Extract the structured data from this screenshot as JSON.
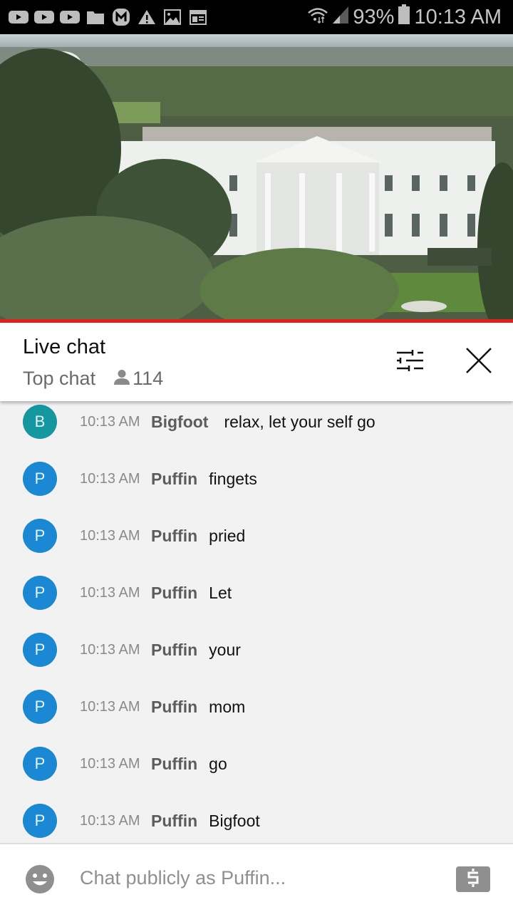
{
  "status_bar": {
    "notification_icons": [
      "youtube-icon",
      "youtube-icon",
      "youtube-icon",
      "folder-icon",
      "m-app-icon",
      "warning-icon",
      "image-icon",
      "news-icon"
    ],
    "signal_icons": [
      "wifi-data-icon",
      "cell-signal-icon"
    ],
    "battery": "93%",
    "time": "10:13 AM"
  },
  "video": {
    "description": "Live camera view of the White House",
    "progress_percent": 100,
    "progress_color": "#e31e1e"
  },
  "chat_header": {
    "title": "Live chat",
    "mode": "Top chat",
    "viewer_count": "114",
    "filter_icon": "sliders-icon",
    "close_icon": "close-icon"
  },
  "messages": [
    {
      "initial": "B",
      "avatar_color": "#14979f",
      "time": "10:13 AM",
      "author": "Bigfoot",
      "text": "relax, let your self go"
    },
    {
      "initial": "P",
      "avatar_color": "#1a88d3",
      "time": "10:13 AM",
      "author": "Puffin",
      "text": "fingets"
    },
    {
      "initial": "P",
      "avatar_color": "#1a88d3",
      "time": "10:13 AM",
      "author": "Puffin",
      "text": "pried"
    },
    {
      "initial": "P",
      "avatar_color": "#1a88d3",
      "time": "10:13 AM",
      "author": "Puffin",
      "text": "Let"
    },
    {
      "initial": "P",
      "avatar_color": "#1a88d3",
      "time": "10:13 AM",
      "author": "Puffin",
      "text": "your"
    },
    {
      "initial": "P",
      "avatar_color": "#1a88d3",
      "time": "10:13 AM",
      "author": "Puffin",
      "text": "mom"
    },
    {
      "initial": "P",
      "avatar_color": "#1a88d3",
      "time": "10:13 AM",
      "author": "Puffin",
      "text": "go"
    },
    {
      "initial": "P",
      "avatar_color": "#1a88d3",
      "time": "10:13 AM",
      "author": "Puffin",
      "text": "Bigfoot"
    }
  ],
  "input_bar": {
    "placeholder": "Chat publicly as Puffin...",
    "emoji_icon": "emoji-icon",
    "super_chat_icon": "dollar-icon"
  }
}
